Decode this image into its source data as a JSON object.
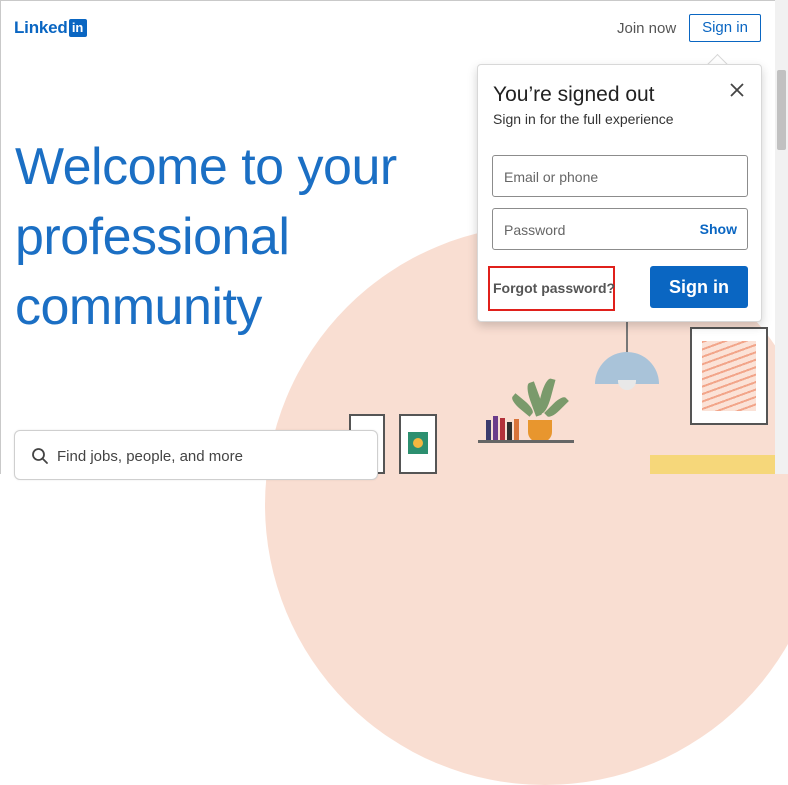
{
  "header": {
    "logo_text": "Linked",
    "logo_box_text": "in",
    "join_label": "Join now",
    "signin_label": "Sign in"
  },
  "hero": {
    "headline_lines": [
      "Welcome to your",
      "professional",
      "community"
    ]
  },
  "search": {
    "placeholder": "Find jobs, people, and more"
  },
  "popup": {
    "title": "You’re signed out",
    "subtitle": "Sign in for the full experience",
    "email_placeholder": "Email or phone",
    "password_placeholder": "Password",
    "show_label": "Show",
    "forgot_label": "Forgot password?",
    "signin_label": "Sign in"
  },
  "colors": {
    "brand": "#0a66c2",
    "headline": "#1b6fc4",
    "highlight_border": "#e0201b",
    "illustration_bg": "#f9ded2"
  },
  "icons": [
    "search-icon",
    "close-icon"
  ]
}
